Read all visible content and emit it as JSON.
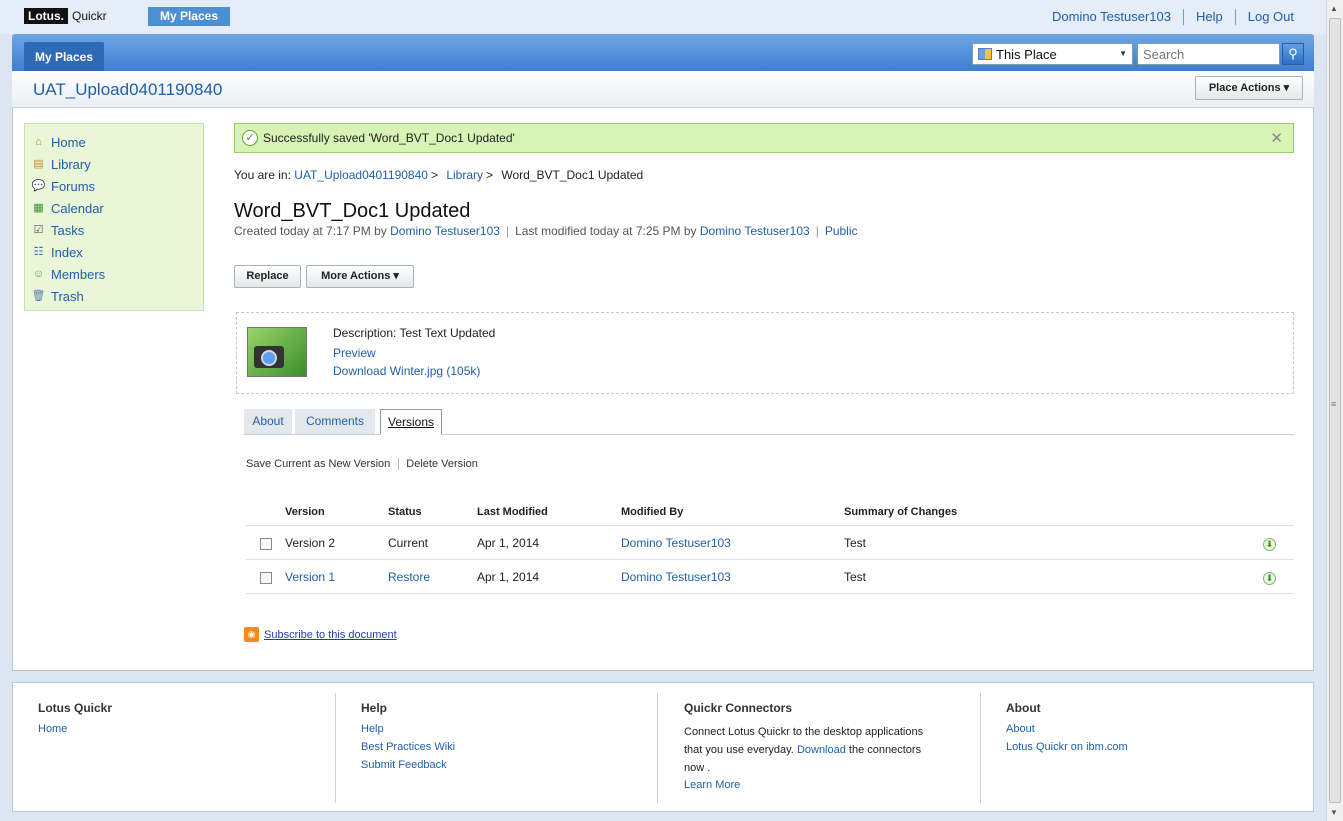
{
  "topbar": {
    "logo_lotus": "Lotus.",
    "logo_quickr": "Quickr",
    "my_places": "My Places",
    "user": "Domino Testuser103",
    "help": "Help",
    "logout": "Log Out"
  },
  "bluebar": {
    "tab": "My Places",
    "scope": "This Place",
    "search_placeholder": "Search"
  },
  "place": {
    "title": "UAT_Upload0401190840",
    "actions": "Place Actions"
  },
  "sidebar": {
    "items": [
      {
        "label": "Home",
        "icon": "home-icon"
      },
      {
        "label": "Library",
        "icon": "library-icon"
      },
      {
        "label": "Forums",
        "icon": "forums-icon"
      },
      {
        "label": "Calendar",
        "icon": "calendar-icon"
      },
      {
        "label": "Tasks",
        "icon": "tasks-icon"
      },
      {
        "label": "Index",
        "icon": "index-icon"
      },
      {
        "label": "Members",
        "icon": "members-icon"
      },
      {
        "label": "Trash",
        "icon": "trash-icon"
      }
    ]
  },
  "message": {
    "text": "Successfully saved 'Word_BVT_Doc1 Updated'"
  },
  "breadcrumb": {
    "prefix": "You are in:",
    "place": "UAT_Upload0401190840",
    "library": "Library",
    "current": "Word_BVT_Doc1 Updated",
    "sep": ">"
  },
  "document": {
    "title": "Word_BVT_Doc1 Updated",
    "created": "Created today at 7:17 PM by",
    "created_by": "Domino Testuser103",
    "modified": "Last modified today at 7:25 PM by",
    "modified_by": "Domino Testuser103",
    "access": "Public",
    "replace": "Replace",
    "more_actions": "More Actions"
  },
  "attachment": {
    "description": "Description: Test Text Updated",
    "preview": "Preview",
    "download": "Download Winter.jpg (105k)"
  },
  "tabs": {
    "about": "About",
    "comments": "Comments",
    "versions": "Versions"
  },
  "versions": {
    "save_current": "Save Current as New Version",
    "delete": "Delete Version",
    "headers": {
      "version": "Version",
      "status": "Status",
      "last_modified": "Last Modified",
      "modified_by": "Modified By",
      "summary": "Summary of Changes"
    },
    "rows": [
      {
        "version": "Version 2",
        "status": "Current",
        "last_modified": "Apr 1, 2014",
        "modified_by": "Domino Testuser103",
        "summary": "Test"
      },
      {
        "version": "Version 1",
        "status": "Restore",
        "last_modified": "Apr 1, 2014",
        "modified_by": "Domino Testuser103",
        "summary": "Test"
      }
    ]
  },
  "subscribe": "Subscribe to this document",
  "footer": {
    "col1": {
      "title": "Lotus Quickr",
      "links": [
        "Home"
      ]
    },
    "col2": {
      "title": "Help",
      "links": [
        "Help",
        "Best Practices Wiki",
        "Submit Feedback"
      ]
    },
    "col3": {
      "title": "Quickr Connectors",
      "text1": "Connect Lotus Quickr to the desktop applications",
      "text2": "that you use everyday.",
      "download": "Download",
      "text3": "the connectors",
      "text4": "now .",
      "learn_more": "Learn More"
    },
    "col4": {
      "title": "About",
      "links": [
        "About",
        "Lotus Quickr on ibm.com"
      ]
    }
  }
}
